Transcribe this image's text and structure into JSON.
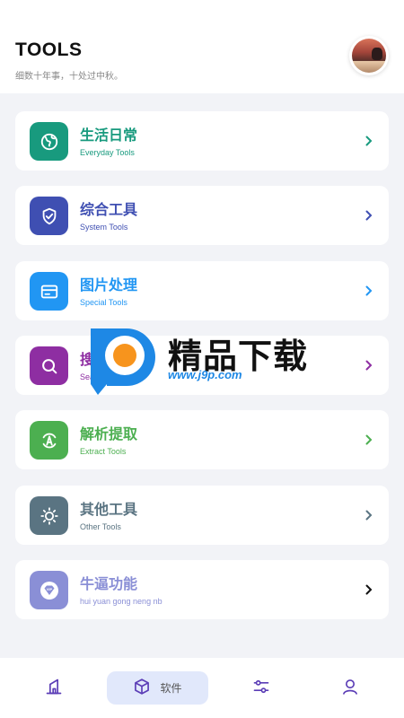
{
  "header": {
    "title": "TOOLS",
    "subtitle": "细数十年事，十处过中秋。"
  },
  "categories": [
    {
      "title": "生活日常",
      "subtitle": "Everyday Tools",
      "color": "#189a7e",
      "icon": "globe-icon"
    },
    {
      "title": "综合工具",
      "subtitle": "System Tools",
      "color": "#3f4fb2",
      "icon": "shield-check-icon"
    },
    {
      "title": "图片处理",
      "subtitle": "Special Tools",
      "color": "#2196f3",
      "icon": "card-icon"
    },
    {
      "title": "搜索资源",
      "subtitle": "Search Tools",
      "color": "#8e2ea2",
      "icon": "search-icon"
    },
    {
      "title": "解析提取",
      "subtitle": "Extract Tools",
      "color": "#4caf50",
      "icon": "extract-icon"
    },
    {
      "title": "其他工具",
      "subtitle": "Other Tools",
      "color": "#5a7482",
      "icon": "sun-gear-icon"
    },
    {
      "title": "牛逼功能",
      "subtitle": "hui yuan gong neng nb",
      "color": "#8a8fd6",
      "icon": "vip-diamond-icon"
    }
  ],
  "watermark": {
    "text": "精品下载",
    "url": "www.j9p.com"
  },
  "bottom_nav": {
    "items": [
      {
        "icon": "home-icon",
        "label": ""
      },
      {
        "icon": "cube-icon",
        "label": "软件",
        "active": true
      },
      {
        "icon": "sliders-icon",
        "label": ""
      },
      {
        "icon": "user-icon",
        "label": ""
      }
    ],
    "accent": "#5b3db6"
  }
}
